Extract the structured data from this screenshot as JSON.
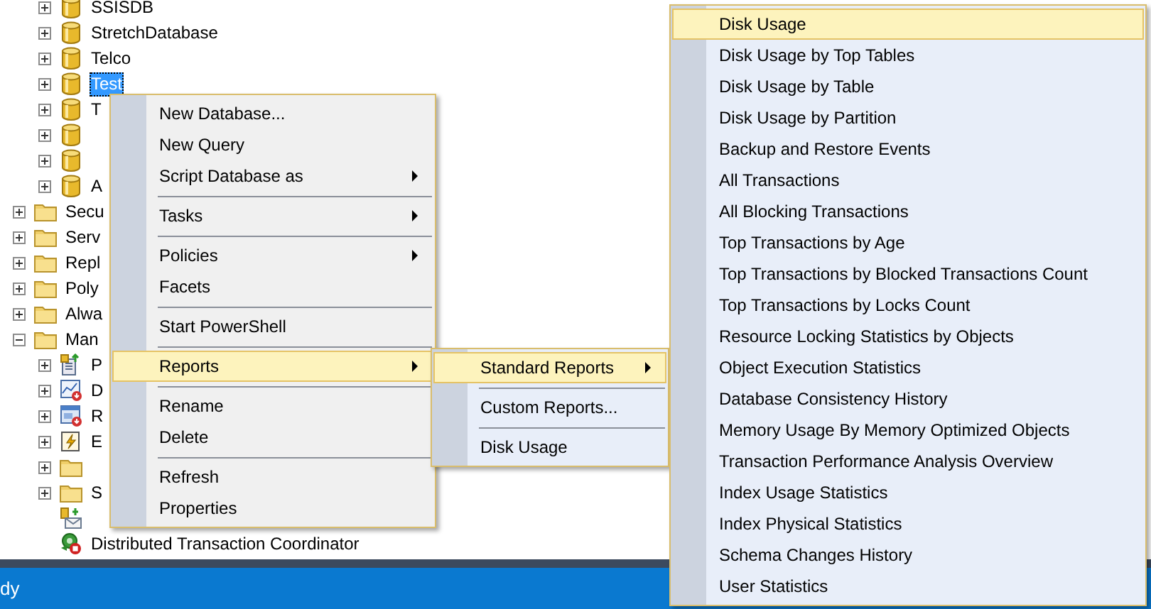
{
  "tree": {
    "database_items": [
      {
        "label": "SSISDB",
        "kind": "database",
        "expanded": false,
        "selected": false
      },
      {
        "label": "StretchDatabase",
        "kind": "database",
        "expanded": false,
        "selected": false
      },
      {
        "label": "Telco",
        "kind": "database",
        "expanded": false,
        "selected": false
      },
      {
        "label": "Test",
        "kind": "database",
        "expanded": false,
        "selected": true
      },
      {
        "label": "T",
        "kind": "database",
        "expanded": false,
        "selected": false
      },
      {
        "kind": "database",
        "expanded": false,
        "selected": false
      },
      {
        "kind": "database",
        "expanded": false,
        "selected": false
      },
      {
        "label": "A",
        "kind": "database",
        "expanded": false,
        "selected": false
      }
    ],
    "items": [
      {
        "label": "Secu",
        "kind": "folder",
        "expanded": false,
        "selected": false
      },
      {
        "label": "Serv",
        "kind": "folder",
        "expanded": false,
        "selected": false
      },
      {
        "label": "Repl",
        "kind": "folder",
        "expanded": false,
        "selected": false
      },
      {
        "label": "Poly",
        "kind": "folder",
        "expanded": false,
        "selected": false
      },
      {
        "label": "Alwa",
        "kind": "folder",
        "expanded": false,
        "selected": false
      },
      {
        "label": "Man",
        "kind": "folder",
        "expanded": true,
        "selected": false,
        "children": [
          {
            "label": "P",
            "kind": "policy",
            "expanded": false,
            "selected": false
          },
          {
            "label": "D",
            "kind": "chart",
            "expanded": false,
            "selected": false
          },
          {
            "label": "R",
            "kind": "window",
            "expanded": false,
            "selected": false
          },
          {
            "label": "E",
            "kind": "lightning",
            "expanded": false,
            "selected": false
          },
          {
            "kind": "folder",
            "expanded": false,
            "selected": false
          },
          {
            "label": "S",
            "kind": "folder",
            "expanded": false,
            "selected": false
          },
          {
            "kind": "mail",
            "selected": false
          },
          {
            "label": "Distributed Transaction Coordinator",
            "kind": "coordinator",
            "selected": false
          }
        ]
      }
    ]
  },
  "context_menu": {
    "items": [
      {
        "kind": "item",
        "label": "New Database...",
        "has_submenu": false,
        "selected": false
      },
      {
        "kind": "item",
        "label": "New Query",
        "has_submenu": false,
        "selected": false
      },
      {
        "kind": "item",
        "label": "Script Database as",
        "has_submenu": true,
        "selected": false
      },
      {
        "kind": "separator"
      },
      {
        "kind": "item",
        "label": "Tasks",
        "has_submenu": true,
        "selected": false
      },
      {
        "kind": "separator"
      },
      {
        "kind": "item",
        "label": "Policies",
        "has_submenu": true,
        "selected": false
      },
      {
        "kind": "item",
        "label": "Facets",
        "has_submenu": false,
        "selected": false
      },
      {
        "kind": "separator"
      },
      {
        "kind": "item",
        "label": "Start PowerShell",
        "has_submenu": false,
        "selected": false
      },
      {
        "kind": "separator"
      },
      {
        "kind": "item",
        "label": "Reports",
        "has_submenu": true,
        "selected": true
      },
      {
        "kind": "separator"
      },
      {
        "kind": "item",
        "label": "Rename",
        "has_submenu": false,
        "selected": false
      },
      {
        "kind": "item",
        "label": "Delete",
        "has_submenu": false,
        "selected": false
      },
      {
        "kind": "separator"
      },
      {
        "kind": "item",
        "label": "Refresh",
        "has_submenu": false,
        "selected": false
      },
      {
        "kind": "item",
        "label": "Properties",
        "has_submenu": false,
        "selected": false
      }
    ]
  },
  "reports_menu": {
    "items": [
      {
        "kind": "item",
        "label": "Standard Reports",
        "has_submenu": true,
        "selected": true
      },
      {
        "kind": "separator"
      },
      {
        "kind": "item",
        "label": "Custom Reports...",
        "has_submenu": false,
        "selected": false
      },
      {
        "kind": "separator"
      },
      {
        "kind": "item",
        "label": "Disk Usage",
        "has_submenu": false,
        "selected": false
      }
    ]
  },
  "standard_reports_menu": {
    "items": [
      {
        "kind": "item",
        "label": "Disk Usage",
        "has_submenu": false,
        "selected": true
      },
      {
        "kind": "item",
        "label": "Disk Usage by Top Tables",
        "has_submenu": false,
        "selected": false
      },
      {
        "kind": "item",
        "label": "Disk Usage by Table",
        "has_submenu": false,
        "selected": false
      },
      {
        "kind": "item",
        "label": "Disk Usage by Partition",
        "has_submenu": false,
        "selected": false
      },
      {
        "kind": "item",
        "label": "Backup and Restore Events",
        "has_submenu": false,
        "selected": false
      },
      {
        "kind": "item",
        "label": "All Transactions",
        "has_submenu": false,
        "selected": false
      },
      {
        "kind": "item",
        "label": "All Blocking Transactions",
        "has_submenu": false,
        "selected": false
      },
      {
        "kind": "item",
        "label": "Top Transactions by Age",
        "has_submenu": false,
        "selected": false
      },
      {
        "kind": "item",
        "label": "Top Transactions by Blocked Transactions Count",
        "has_submenu": false,
        "selected": false
      },
      {
        "kind": "item",
        "label": "Top Transactions by Locks Count",
        "has_submenu": false,
        "selected": false
      },
      {
        "kind": "item",
        "label": "Resource Locking Statistics by Objects",
        "has_submenu": false,
        "selected": false
      },
      {
        "kind": "item",
        "label": "Object Execution Statistics",
        "has_submenu": false,
        "selected": false
      },
      {
        "kind": "item",
        "label": "Database Consistency History",
        "has_submenu": false,
        "selected": false
      },
      {
        "kind": "item",
        "label": "Memory Usage By Memory Optimized Objects",
        "has_submenu": false,
        "selected": false
      },
      {
        "kind": "item",
        "label": "Transaction Performance Analysis Overview",
        "has_submenu": false,
        "selected": false
      },
      {
        "kind": "item",
        "label": "Index Usage Statistics",
        "has_submenu": false,
        "selected": false
      },
      {
        "kind": "item",
        "label": "Index Physical Statistics",
        "has_submenu": false,
        "selected": false
      },
      {
        "kind": "item",
        "label": "Schema Changes History",
        "has_submenu": false,
        "selected": false
      },
      {
        "kind": "item",
        "label": "User Statistics",
        "has_submenu": false,
        "selected": false
      }
    ]
  },
  "status_bar": {
    "text": "dy"
  }
}
